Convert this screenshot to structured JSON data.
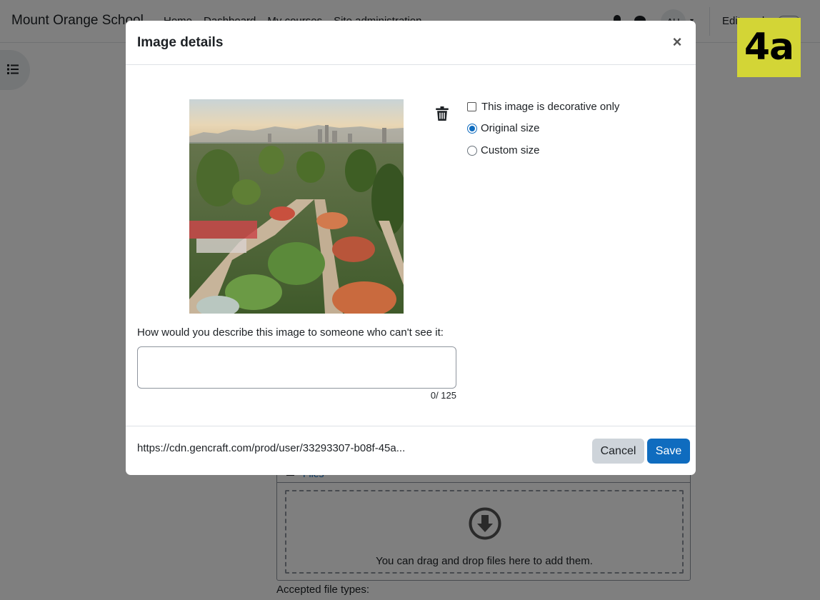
{
  "navbar": {
    "site_name": "Mount Orange School",
    "links": [
      "Home",
      "Dashboard",
      "My courses",
      "Site administration"
    ],
    "avatar_initials": "AU",
    "edit_mode_label": "Edit mode"
  },
  "files": {
    "header_link": "Files",
    "drop_text": "You can drag and drop files here to add them.",
    "accepted_label": "Accepted file types:"
  },
  "modal": {
    "title": "Image details",
    "close_symbol": "×",
    "options": {
      "decorative_label": "This image is decorative only",
      "original_size_label": "Original size",
      "custom_size_label": "Custom size",
      "selected": "original_size"
    },
    "alt_label": "How would you describe this image to someone who can't see it:",
    "alt_value": "",
    "char_count": "0/ 125",
    "url": "https://cdn.gencraft.com/prod/user/33293307-b08f-45a...",
    "cancel_label": "Cancel",
    "save_label": "Save"
  },
  "badge_text": "4a",
  "colors": {
    "primary": "#0f6cbf",
    "secondary_button": "#ced4da",
    "badge": "#d3d536"
  }
}
